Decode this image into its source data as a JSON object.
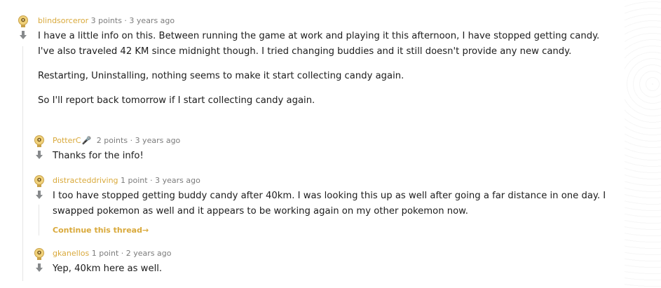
{
  "comments": [
    {
      "author": "blindsorceror",
      "points": "3 points",
      "time": "3 years ago",
      "paragraphs": [
        "I have a little info on this. Between running the game at work and playing it this afternoon, I have stopped getting candy. I've also traveled 42 KM since midnight though. I tried changing buddies and it still doesn't provide any new candy.",
        "Restarting, Uninstalling, nothing seems to make it start collecting candy again.",
        "So I'll report back tomorrow if I start collecting candy again."
      ]
    },
    {
      "author": "PotterC",
      "points": "2 points",
      "time": "3 years ago",
      "paragraphs": [
        "Thanks for the info!"
      ]
    },
    {
      "author": "distracteddriving",
      "points": "1 point",
      "time": "3 years ago",
      "paragraphs": [
        "I too have stopped getting buddy candy after 40km. I was looking this up as well after going a far distance in one day. I swapped pokemon as well and it appears to be working again on my other pokemon now."
      ],
      "continue_label": "Continue this thread"
    },
    {
      "author": "gkanellos",
      "points": "1 point",
      "time": "2 years ago",
      "paragraphs": [
        "Yep, 40km here as well."
      ]
    }
  ],
  "separator": "·",
  "colors": {
    "author": "#d9a93b",
    "meta": "#7c7c7c",
    "flair_icon": "#2a9fd8"
  },
  "icons": {
    "avatar": "snoo-avatar-icon",
    "downvote": "downvote-arrow-icon",
    "flair": "microphone-icon",
    "continue": "arrow-right-icon"
  }
}
